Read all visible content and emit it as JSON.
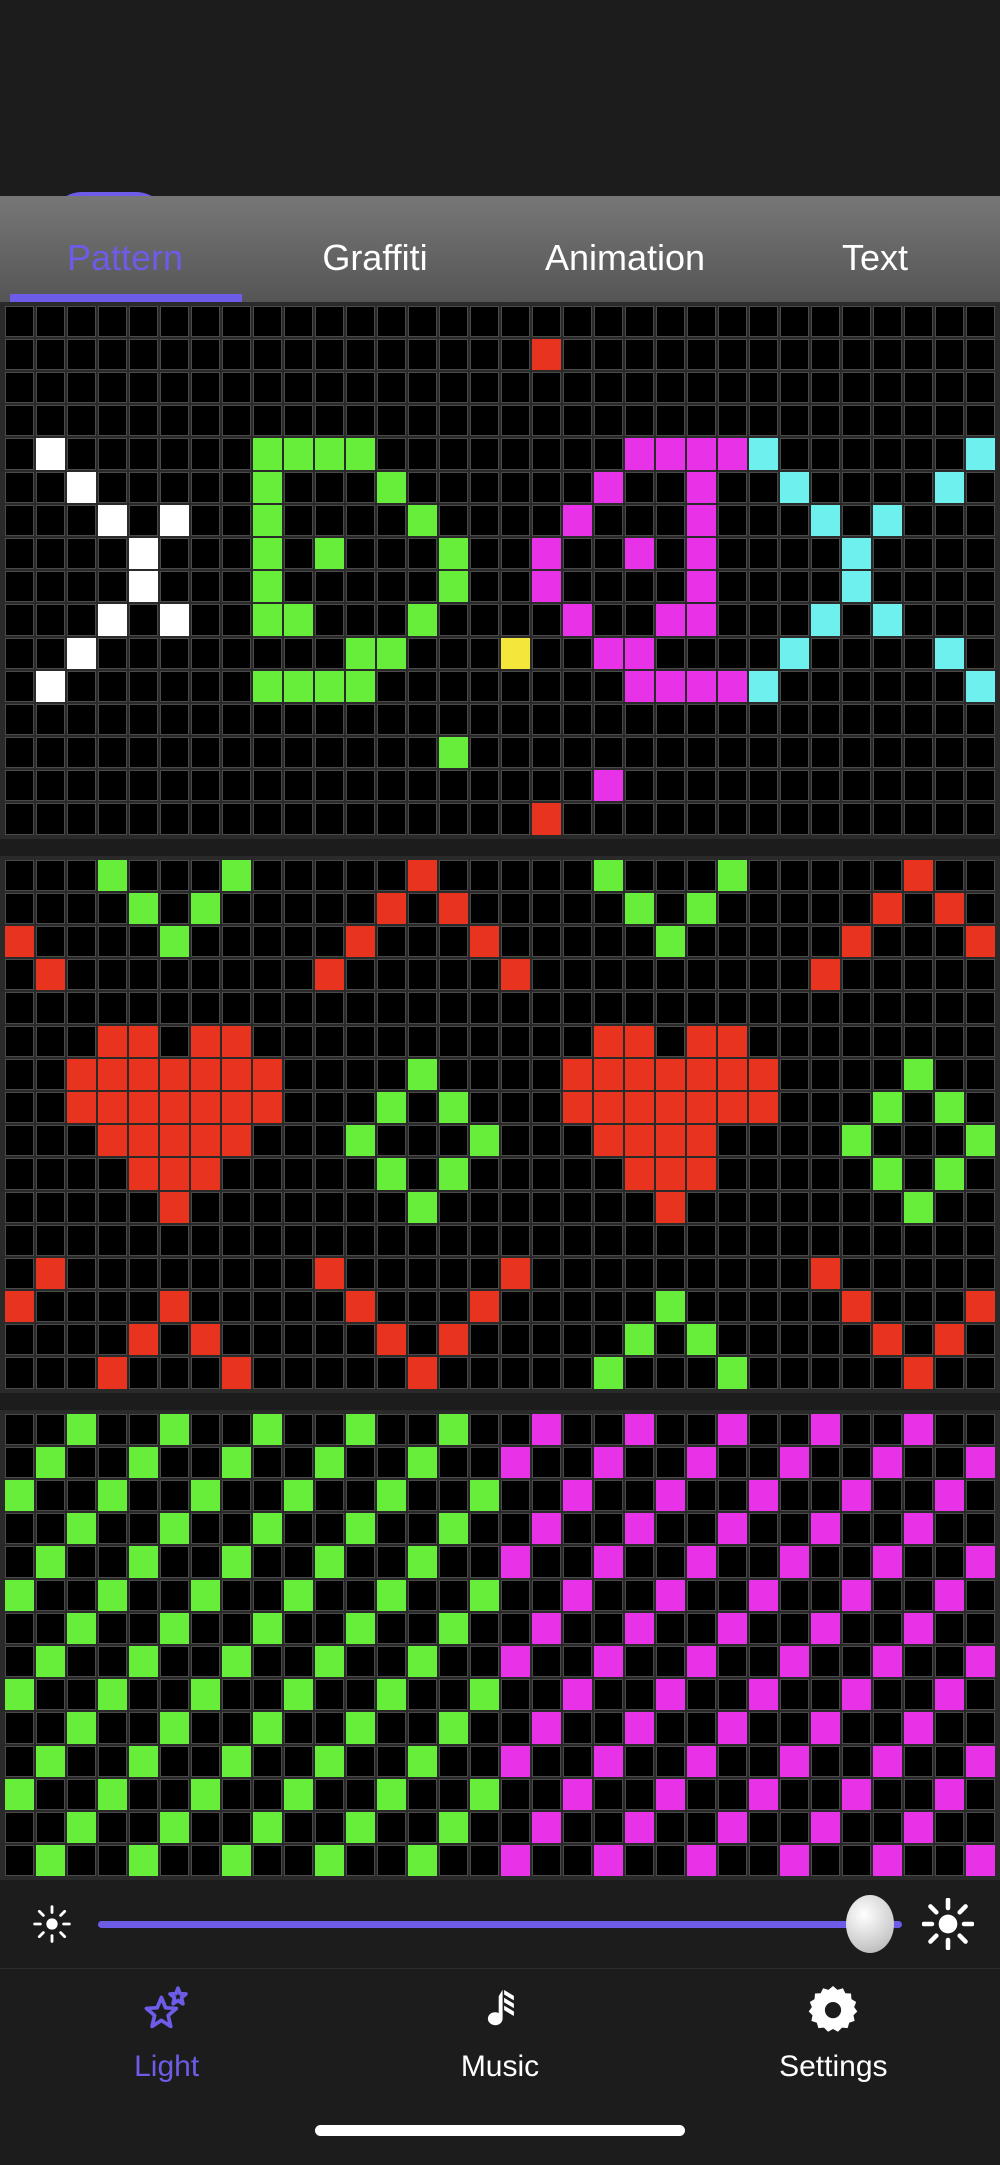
{
  "header": {
    "title": "Light",
    "power_toggle_state": "on"
  },
  "tabs": [
    {
      "label": "Pattern",
      "active": true
    },
    {
      "label": "Graffiti",
      "active": false
    },
    {
      "label": "Animation",
      "active": false
    },
    {
      "label": "Text",
      "active": false
    }
  ],
  "palette": {
    "white": "#ffffff",
    "green": "#66ee3b",
    "magenta": "#e832e8",
    "cyan": "#6ef0ee",
    "red": "#e8331f",
    "yellow": "#f5e63c",
    "accent": "#6c5ce7",
    "cell_off": "#000000",
    "grid_line": "#4a4a4a",
    "panel_bg": "#2a2a2a"
  },
  "brightness": {
    "value_percent": 96,
    "min_icon": "brightness-low-icon",
    "max_icon": "brightness-high-icon"
  },
  "bottom_nav": [
    {
      "label": "Light",
      "icon": "stars-icon",
      "active": true
    },
    {
      "label": "Music",
      "icon": "music-note-icon",
      "active": false
    },
    {
      "label": "Settings",
      "icon": "gear-icon",
      "active": false
    }
  ],
  "grids": [
    {
      "name": "pattern-grid-xdox",
      "cols": 32,
      "rows": 16,
      "cells": [
        {
          "c": "red",
          "p": [
            [
              1,
              17
            ],
            [
              15,
              17
            ]
          ]
        },
        {
          "c": "white",
          "p": [
            [
              4,
              1
            ],
            [
              5,
              2
            ],
            [
              6,
              3
            ],
            [
              6,
              5
            ],
            [
              7,
              4
            ],
            [
              8,
              4
            ],
            [
              9,
              3
            ],
            [
              9,
              5
            ],
            [
              10,
              2
            ],
            [
              11,
              1
            ]
          ]
        },
        {
          "c": "green",
          "p": [
            [
              4,
              8
            ],
            [
              4,
              9
            ],
            [
              4,
              10
            ],
            [
              4,
              11
            ],
            [
              5,
              8
            ],
            [
              5,
              12
            ],
            [
              6,
              8
            ],
            [
              6,
              13
            ],
            [
              7,
              8
            ],
            [
              7,
              10
            ],
            [
              7,
              14
            ],
            [
              8,
              8
            ],
            [
              8,
              14
            ],
            [
              9,
              8
            ],
            [
              9,
              9
            ],
            [
              9,
              13
            ],
            [
              10,
              11
            ],
            [
              10,
              12
            ],
            [
              11,
              8
            ],
            [
              11,
              9
            ],
            [
              11,
              10
            ],
            [
              11,
              11
            ],
            [
              13,
              14
            ]
          ]
        },
        {
          "c": "magenta",
          "p": [
            [
              4,
              20
            ],
            [
              4,
              21
            ],
            [
              4,
              22
            ],
            [
              4,
              23
            ],
            [
              5,
              19
            ],
            [
              5,
              22
            ],
            [
              6,
              18
            ],
            [
              6,
              22
            ],
            [
              7,
              17
            ],
            [
              7,
              20
            ],
            [
              7,
              22
            ],
            [
              8,
              17
            ],
            [
              8,
              22
            ],
            [
              9,
              18
            ],
            [
              9,
              21
            ],
            [
              9,
              22
            ],
            [
              10,
              19
            ],
            [
              10,
              20
            ],
            [
              11,
              20
            ],
            [
              11,
              21
            ],
            [
              11,
              22
            ],
            [
              11,
              23
            ],
            [
              14,
              19
            ]
          ]
        },
        {
          "c": "cyan",
          "p": [
            [
              4,
              24
            ],
            [
              4,
              31
            ],
            [
              5,
              25
            ],
            [
              5,
              30
            ],
            [
              6,
              26
            ],
            [
              6,
              28
            ],
            [
              7,
              27
            ],
            [
              8,
              27
            ],
            [
              9,
              26
            ],
            [
              9,
              28
            ],
            [
              10,
              25
            ],
            [
              10,
              30
            ],
            [
              11,
              24
            ],
            [
              11,
              31
            ]
          ]
        },
        {
          "c": "yellow",
          "p": [
            [
              10,
              16
            ]
          ]
        }
      ]
    },
    {
      "name": "pattern-grid-hearts",
      "cols": 32,
      "rows": 16,
      "cells": [
        {
          "c": "green",
          "p": [
            [
              0,
              3
            ],
            [
              0,
              7
            ],
            [
              0,
              19
            ],
            [
              0,
              23
            ],
            [
              1,
              4
            ],
            [
              1,
              6
            ],
            [
              1,
              20
            ],
            [
              1,
              22
            ],
            [
              2,
              5
            ],
            [
              2,
              21
            ],
            [
              6,
              13
            ],
            [
              6,
              29
            ],
            [
              7,
              12
            ],
            [
              7,
              14
            ],
            [
              7,
              28
            ],
            [
              7,
              30
            ],
            [
              8,
              11
            ],
            [
              8,
              15
            ],
            [
              8,
              27
            ],
            [
              8,
              31
            ],
            [
              9,
              12
            ],
            [
              9,
              14
            ],
            [
              9,
              28
            ],
            [
              9,
              30
            ],
            [
              10,
              13
            ],
            [
              10,
              29
            ],
            [
              13,
              21
            ],
            [
              14,
              20
            ],
            [
              14,
              22
            ],
            [
              15,
              19
            ],
            [
              15,
              23
            ]
          ]
        },
        {
          "c": "red",
          "p": [
            [
              0,
              13
            ],
            [
              0,
              29
            ],
            [
              1,
              12
            ],
            [
              1,
              14
            ],
            [
              1,
              28
            ],
            [
              1,
              30
            ],
            [
              2,
              0
            ],
            [
              2,
              11
            ],
            [
              2,
              15
            ],
            [
              2,
              27
            ],
            [
              2,
              31
            ],
            [
              3,
              1
            ],
            [
              3,
              10
            ],
            [
              3,
              16
            ],
            [
              3,
              26
            ],
            [
              5,
              3
            ],
            [
              5,
              4
            ],
            [
              5,
              6
            ],
            [
              5,
              7
            ],
            [
              5,
              19
            ],
            [
              5,
              20
            ],
            [
              5,
              22
            ],
            [
              5,
              23
            ],
            [
              6,
              2
            ],
            [
              6,
              3
            ],
            [
              6,
              4
            ],
            [
              6,
              5
            ],
            [
              6,
              6
            ],
            [
              6,
              7
            ],
            [
              6,
              8
            ],
            [
              6,
              18
            ],
            [
              6,
              19
            ],
            [
              6,
              20
            ],
            [
              6,
              21
            ],
            [
              6,
              22
            ],
            [
              6,
              23
            ],
            [
              6,
              24
            ],
            [
              7,
              2
            ],
            [
              7,
              3
            ],
            [
              7,
              4
            ],
            [
              7,
              5
            ],
            [
              7,
              6
            ],
            [
              7,
              7
            ],
            [
              7,
              8
            ],
            [
              7,
              18
            ],
            [
              7,
              19
            ],
            [
              7,
              20
            ],
            [
              7,
              21
            ],
            [
              7,
              22
            ],
            [
              7,
              23
            ],
            [
              7,
              24
            ],
            [
              8,
              3
            ],
            [
              8,
              4
            ],
            [
              8,
              5
            ],
            [
              8,
              6
            ],
            [
              8,
              7
            ],
            [
              8,
              19
            ],
            [
              8,
              20
            ],
            [
              8,
              21
            ],
            [
              8,
              22
            ],
            [
              9,
              4
            ],
            [
              9,
              5
            ],
            [
              9,
              6
            ],
            [
              9,
              20
            ],
            [
              9,
              21
            ],
            [
              9,
              22
            ],
            [
              10,
              5
            ],
            [
              10,
              21
            ],
            [
              12,
              1
            ],
            [
              12,
              10
            ],
            [
              12,
              16
            ],
            [
              12,
              26
            ],
            [
              13,
              0
            ],
            [
              13,
              5
            ],
            [
              13,
              11
            ],
            [
              13,
              15
            ],
            [
              13,
              27
            ],
            [
              13,
              31
            ],
            [
              14,
              4
            ],
            [
              14,
              6
            ],
            [
              14,
              12
            ],
            [
              14,
              14
            ],
            [
              14,
              28
            ],
            [
              14,
              30
            ],
            [
              15,
              3
            ],
            [
              15,
              7
            ],
            [
              15,
              13
            ],
            [
              15,
              29
            ]
          ]
        }
      ]
    },
    {
      "name": "pattern-grid-diagonal-stripes",
      "cols": 32,
      "rows": 14,
      "pattern": "period3-diagonal",
      "left_color": "green",
      "right_color": "magenta",
      "split_col": 16
    }
  ]
}
